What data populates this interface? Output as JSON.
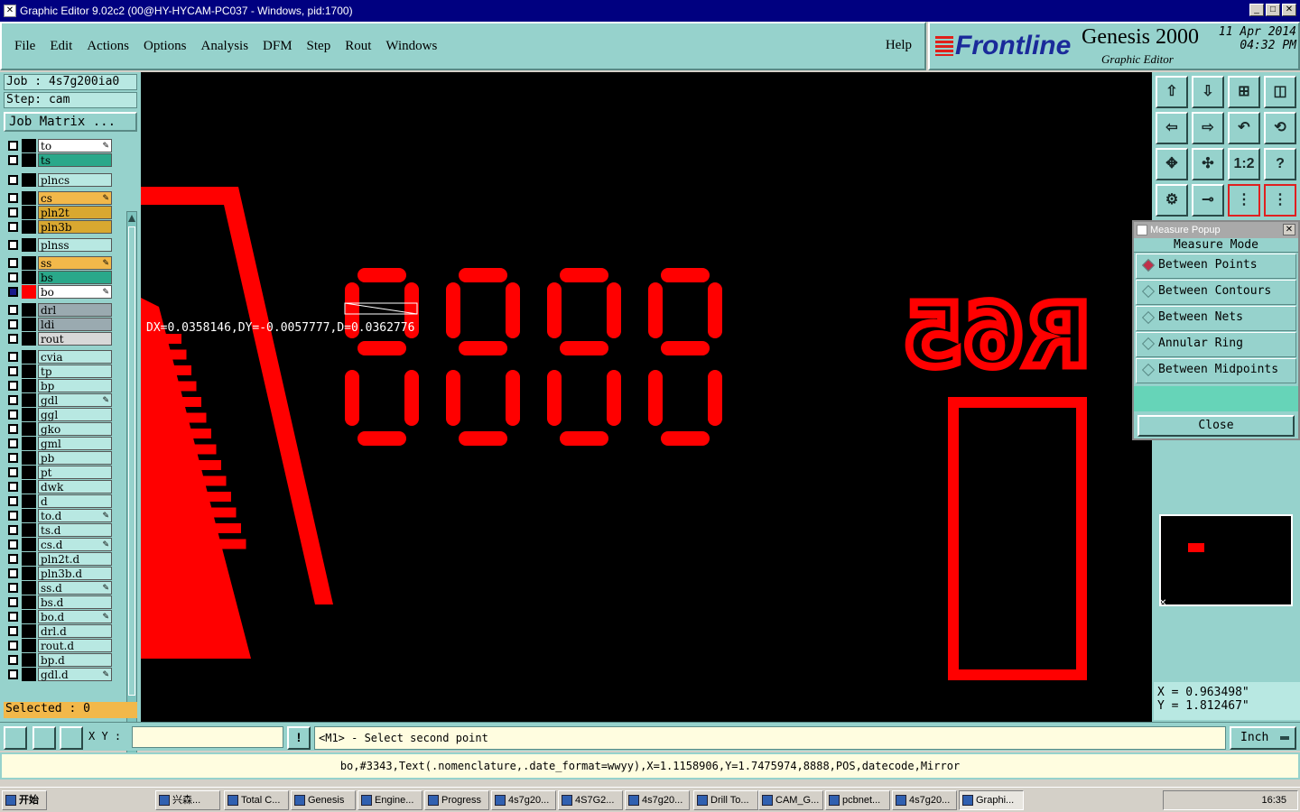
{
  "window": {
    "title": "Graphic Editor 9.02c2 (00@HY-HYCAM-PC037 - Windows, pid:1700)"
  },
  "menu": {
    "items": [
      "File",
      "Edit",
      "Actions",
      "Options",
      "Analysis",
      "DFM",
      "Step",
      "Rout",
      "Windows"
    ],
    "help": "Help"
  },
  "brand": {
    "logo": "Frontline",
    "product": "Genesis 2000",
    "subtitle": "Graphic Editor",
    "date": "11 Apr 2014",
    "time": "04:32 PM"
  },
  "job": {
    "job_label": "Job : 4s7g200ia0",
    "step_label": "Step: cam",
    "matrix_button": "Job Matrix ..."
  },
  "layers": [
    {
      "name": "to",
      "color": "#ffffff",
      "swatch": "#000000",
      "pen": true
    },
    {
      "name": "ts",
      "color": "#2aa88a",
      "swatch": "#000000",
      "pen": false
    },
    {
      "name": "plncs",
      "color": "#b8e8e2",
      "swatch": "#000000",
      "pen": false
    },
    {
      "name": "cs",
      "color": "#f2b84a",
      "swatch": "#000000",
      "pen": true
    },
    {
      "name": "pln2t",
      "color": "#d9a830",
      "swatch": "#000000",
      "pen": false
    },
    {
      "name": "pln3b",
      "color": "#d9a830",
      "swatch": "#000000",
      "pen": false
    },
    {
      "name": "plnss",
      "color": "#b8e8e2",
      "swatch": "#000000",
      "pen": false
    },
    {
      "name": "ss",
      "color": "#f2b84a",
      "swatch": "#000000",
      "pen": true
    },
    {
      "name": "bs",
      "color": "#2aa88a",
      "swatch": "#000000",
      "pen": false
    },
    {
      "name": "bo",
      "color": "#ffffff",
      "swatch": "#ff0000",
      "pen": true,
      "active": true
    },
    {
      "name": "drl",
      "color": "#9aaab0",
      "swatch": "#000000",
      "pen": false
    },
    {
      "name": "ldi",
      "color": "#9aaab0",
      "swatch": "#000000",
      "pen": false
    },
    {
      "name": "rout",
      "color": "#d8d8d8",
      "swatch": "#000000",
      "pen": false
    },
    {
      "name": "cvia",
      "color": "#b8e8e2",
      "swatch": "#000000",
      "pen": false
    },
    {
      "name": "tp",
      "color": "#b8e8e2",
      "swatch": "#000000",
      "pen": false
    },
    {
      "name": "bp",
      "color": "#b8e8e2",
      "swatch": "#000000",
      "pen": false
    },
    {
      "name": "gdl",
      "color": "#b8e8e2",
      "swatch": "#000000",
      "pen": true
    },
    {
      "name": "ggl",
      "color": "#b8e8e2",
      "swatch": "#000000",
      "pen": false
    },
    {
      "name": "gko",
      "color": "#b8e8e2",
      "swatch": "#000000",
      "pen": false
    },
    {
      "name": "gml",
      "color": "#b8e8e2",
      "swatch": "#000000",
      "pen": false
    },
    {
      "name": "pb",
      "color": "#b8e8e2",
      "swatch": "#000000",
      "pen": false
    },
    {
      "name": "pt",
      "color": "#b8e8e2",
      "swatch": "#000000",
      "pen": false
    },
    {
      "name": "dwk",
      "color": "#b8e8e2",
      "swatch": "#000000",
      "pen": false
    },
    {
      "name": "d",
      "color": "#b8e8e2",
      "swatch": "#000000",
      "pen": false
    },
    {
      "name": "to.d",
      "color": "#b8e8e2",
      "swatch": "#000000",
      "pen": true
    },
    {
      "name": "ts.d",
      "color": "#b8e8e2",
      "swatch": "#000000",
      "pen": false
    },
    {
      "name": "cs.d",
      "color": "#b8e8e2",
      "swatch": "#000000",
      "pen": true
    },
    {
      "name": "pln2t.d",
      "color": "#b8e8e2",
      "swatch": "#000000",
      "pen": false
    },
    {
      "name": "pln3b.d",
      "color": "#b8e8e2",
      "swatch": "#000000",
      "pen": false
    },
    {
      "name": "ss.d",
      "color": "#b8e8e2",
      "swatch": "#000000",
      "pen": true
    },
    {
      "name": "bs.d",
      "color": "#b8e8e2",
      "swatch": "#000000",
      "pen": false
    },
    {
      "name": "bo.d",
      "color": "#b8e8e2",
      "swatch": "#000000",
      "pen": true
    },
    {
      "name": "drl.d",
      "color": "#b8e8e2",
      "swatch": "#000000",
      "pen": false
    },
    {
      "name": "rout.d",
      "color": "#b8e8e2",
      "swatch": "#000000",
      "pen": false
    },
    {
      "name": "bp.d",
      "color": "#b8e8e2",
      "swatch": "#000000",
      "pen": false
    },
    {
      "name": "gdl.d",
      "color": "#b8e8e2",
      "swatch": "#000000",
      "pen": true
    }
  ],
  "selected": "Selected : 0",
  "canvas": {
    "measure_text": "DX=0.0358146,DY=-0.0057777,D=0.0362776",
    "digits": "8888",
    "designator": "R65",
    "accent": "#ff0000"
  },
  "tools": [
    "zoom-home-icon",
    "zoom-down-icon",
    "zoom-window-icon",
    "zoom-area-icon",
    "pan-left-icon",
    "pan-right-icon",
    "undo-zoom-icon",
    "redraw-icon",
    "fit-icon",
    "center-icon",
    "one-to-one-icon",
    "help-icon",
    "measure-tool-icon",
    "snap-icon",
    "layer-a-icon",
    "layer-b-icon"
  ],
  "measure_popup": {
    "header": "Measure Popup",
    "title": "Measure Mode",
    "options": [
      "Between Points",
      "Between Contours",
      "Between Nets",
      "Annular Ring",
      "Between Midpoints"
    ],
    "selected_index": 0,
    "close": "Close"
  },
  "coords": {
    "x": "X  = 0.963498\"",
    "y": "Y  = 1.812467\""
  },
  "cmd": {
    "xy_label": "X Y :",
    "xy_value": "",
    "prompt": "<M1> - Select second point",
    "units": "Inch"
  },
  "status_line": "bo,#3343,Text(.nomenclature,.date_format=wwyy),X=1.1158906,Y=1.7475974,8888,POS,datecode,Mirror",
  "taskbar": {
    "start": "开始",
    "items": [
      "兴森...",
      "Total C...",
      "Genesis",
      "Engine...",
      "Progress",
      "4s7g20...",
      "4S7G2...",
      "4s7g20...",
      "Drill To...",
      "CAM_G...",
      "pcbnet...",
      "4s7g20...",
      "Graphi..."
    ],
    "clock": "16:35"
  }
}
